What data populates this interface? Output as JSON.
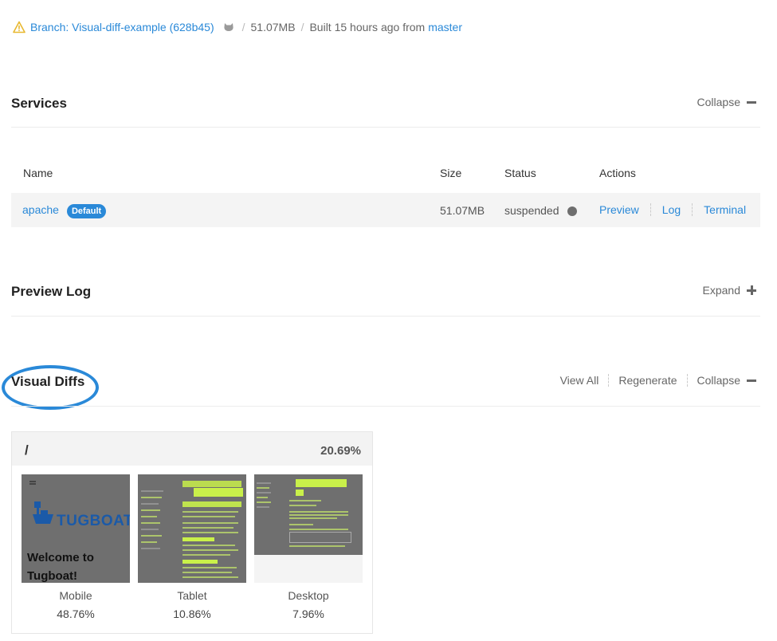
{
  "meta": {
    "branch_label": "Branch: Visual-diff-example (628b45)",
    "size": "51.07MB",
    "built_text": "Built 15 hours ago from",
    "built_branch": "master"
  },
  "services": {
    "title": "Services",
    "collapse_label": "Collapse",
    "columns": [
      "Name",
      "Size",
      "Status",
      "Actions"
    ],
    "row": {
      "name": "apache",
      "badge": "Default",
      "size": "51.07MB",
      "status": "suspended",
      "actions": [
        "Preview",
        "Log",
        "Terminal"
      ]
    }
  },
  "preview_log": {
    "title": "Preview Log",
    "expand_label": "Expand"
  },
  "visual_diffs": {
    "title": "Visual Diffs",
    "view_all_label": "View All",
    "regenerate_label": "Regenerate",
    "collapse_label": "Collapse",
    "card": {
      "path": "/",
      "total_pct": "20.69%",
      "mobile_heading": "Welcome to Tugboat!",
      "logo_text": "TUGBOAT",
      "items": [
        {
          "label": "Mobile",
          "pct": "48.76%"
        },
        {
          "label": "Tablet",
          "pct": "10.86%"
        },
        {
          "label": "Desktop",
          "pct": "7.96%"
        }
      ]
    }
  },
  "colors": {
    "link": "#2a89d8",
    "diff_highlight": "#c9f04a",
    "status_dot": "#6e6e6e"
  }
}
